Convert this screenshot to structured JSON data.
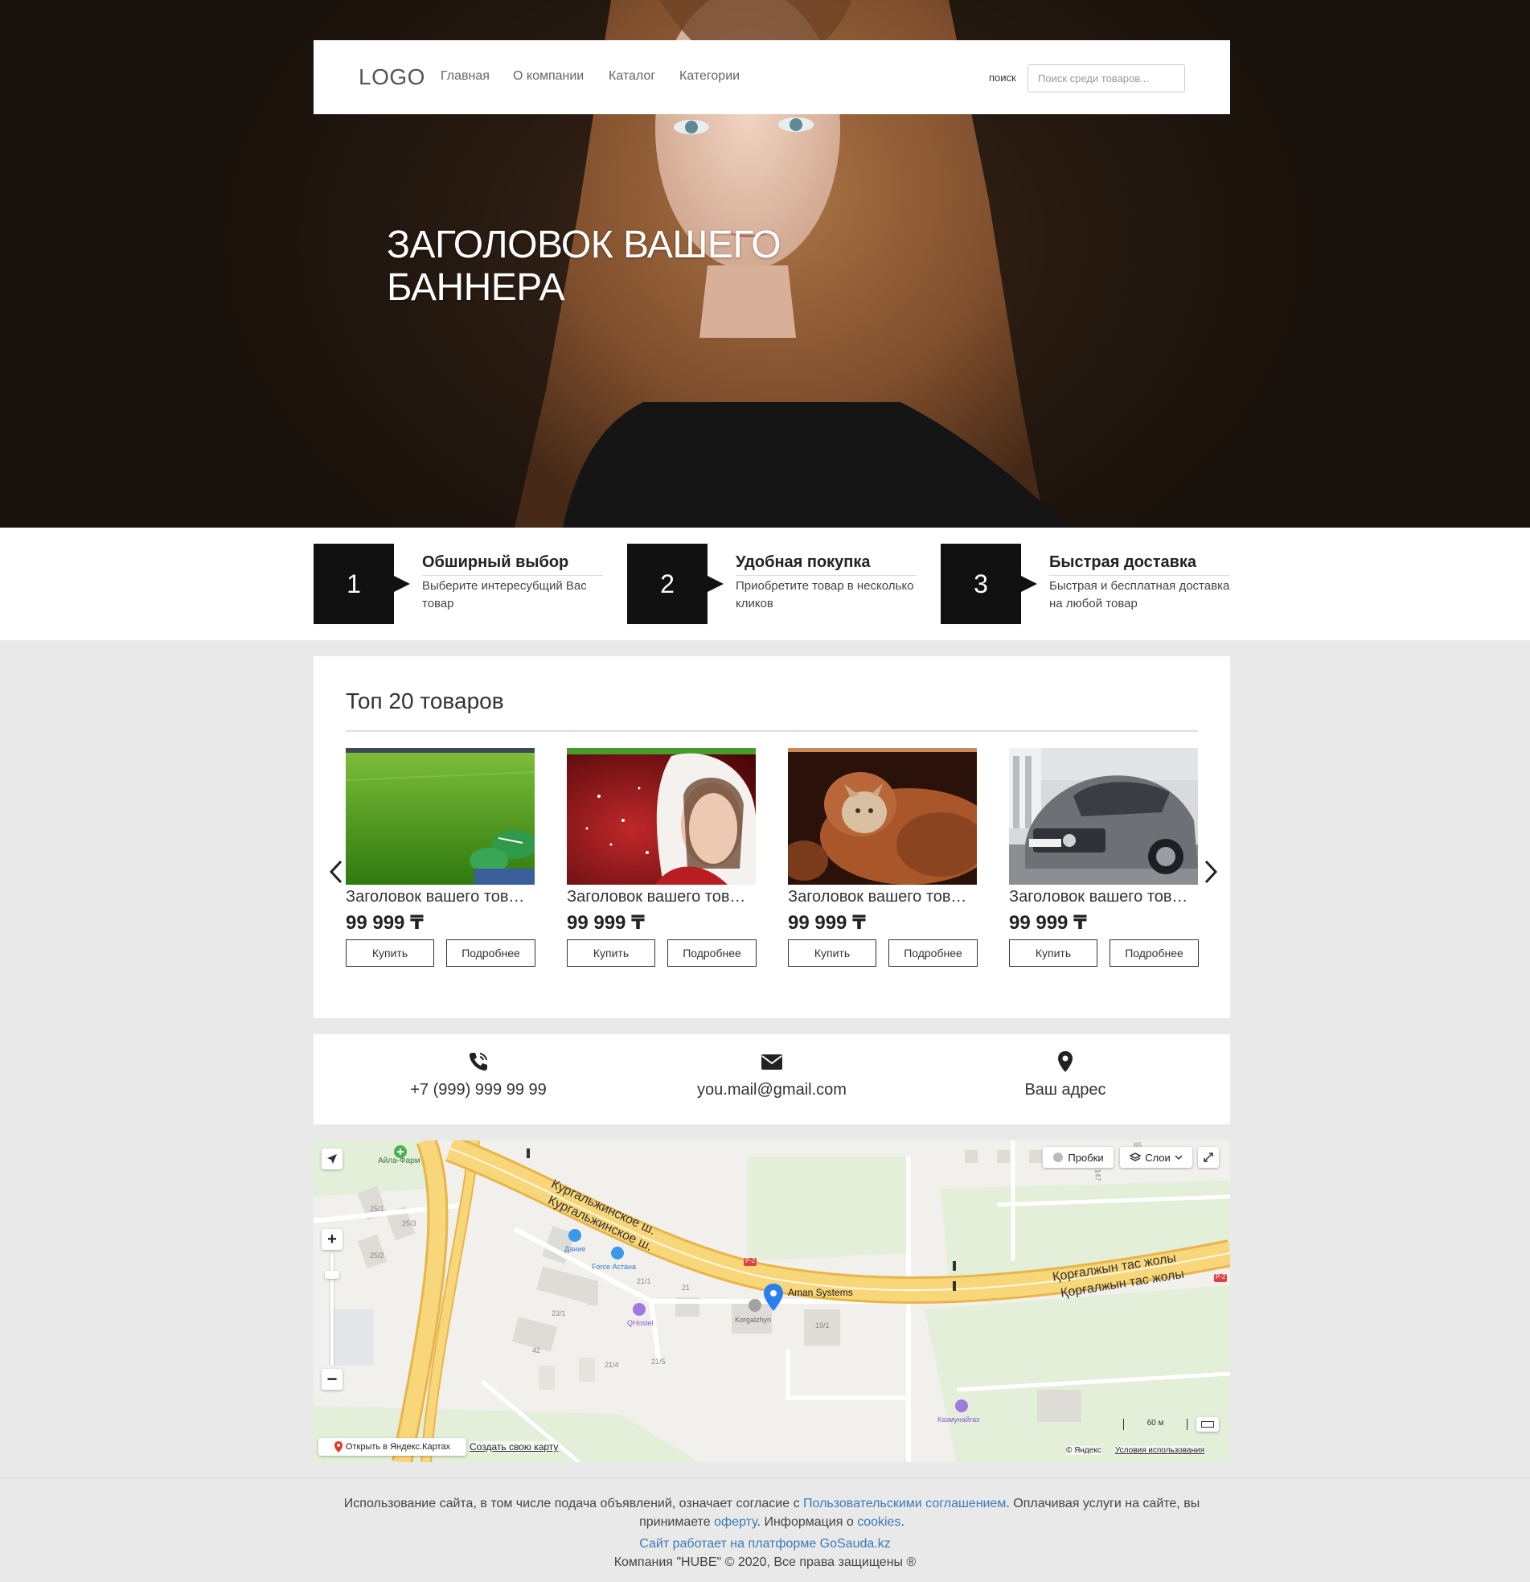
{
  "header": {
    "logo": "LOGO",
    "nav": [
      "Главная",
      "О компании",
      "Каталог",
      "Категории"
    ],
    "search_label": "поиск",
    "search_placeholder": "Поиск среди товаров..."
  },
  "hero": {
    "title": "ЗАГОЛОВОК ВАШЕГО БАННЕРА"
  },
  "features": [
    {
      "num": "1",
      "title": "Обширный выбор",
      "desc": "Выберите интересубщий Вас товар"
    },
    {
      "num": "2",
      "title": "Удобная покупка",
      "desc": "Приобретите товар в несколько кликов"
    },
    {
      "num": "3",
      "title": "Быстрая доставка",
      "desc": "Быстрая и бесплатная доставка на любой товар"
    }
  ],
  "products": {
    "title": "Топ 20 товаров",
    "items": [
      {
        "name": "Заголовок вашего товара",
        "price": "99 999 ₸",
        "buy": "Купить",
        "more": "Подробнее"
      },
      {
        "name": "Заголовок вашего товара",
        "price": "99 999 ₸",
        "buy": "Купить",
        "more": "Подробнее"
      },
      {
        "name": "Заголовок вашего товара",
        "price": "99 999 ₸",
        "buy": "Купить",
        "more": "Подробнее"
      },
      {
        "name": "Заголовок вашего товара",
        "price": "99 999 ₸",
        "buy": "Купить",
        "more": "Подробнее"
      }
    ],
    "prev_icon": "chevron-left-icon",
    "next_icon": "chevron-right-icon"
  },
  "contacts": {
    "phone": "+7 (999) 999 99 99",
    "email": "you.mail@gmail.com",
    "address": "Ваш адрес"
  },
  "map": {
    "traffic": "Пробки",
    "layers": "Слои",
    "street_ru_1": "Кургальжинское ш.",
    "street_ru_2": "Кургальжинское ш.",
    "street_kz_1": "Қорғалжын тас жолы",
    "street_kz_2": "Қорғалжын тас жолы",
    "pin_label": "Aman Systems",
    "place_pharmacy": "Айла-Фарм",
    "place_dania": "Дания",
    "place_force": "Force Астана",
    "place_hostel": "QHostel",
    "place_korgalzhyn": "Korgalzhyn",
    "place_kazmunaigaz": "Казмунайгаз",
    "road_p2": "Р-2",
    "house_numbers": [
      "25/1",
      "25/3",
      "25/2",
      "23/1",
      "21/1",
      "21",
      "42",
      "21/4",
      "21/5",
      "19/1",
      "147",
      "65"
    ],
    "scale": "60 м",
    "open_link": "Открыть в Яндекс.Картах",
    "create_link": "Создать свою карту",
    "copyright": "© Яндекс",
    "terms": "Условия использования"
  },
  "footer": {
    "text1": "Использование сайта, в том числе подача объявлений, означает согласие с ",
    "link1": "Пользовательскими соглашением",
    "text2": ". Оплачивая услуги на сайте, вы принимаете ",
    "link2": "оферту",
    "text3": ". Информация о ",
    "link3": "cookies",
    "text4": ".",
    "platform": "Сайт работает на платформе GoSauda.kz",
    "copyright": "Компания \"HUBE\" © 2020, Все права защищены ®"
  },
  "colors": {
    "link": "#3a79b8",
    "dark": "#111111",
    "road": "#f5c95c"
  }
}
